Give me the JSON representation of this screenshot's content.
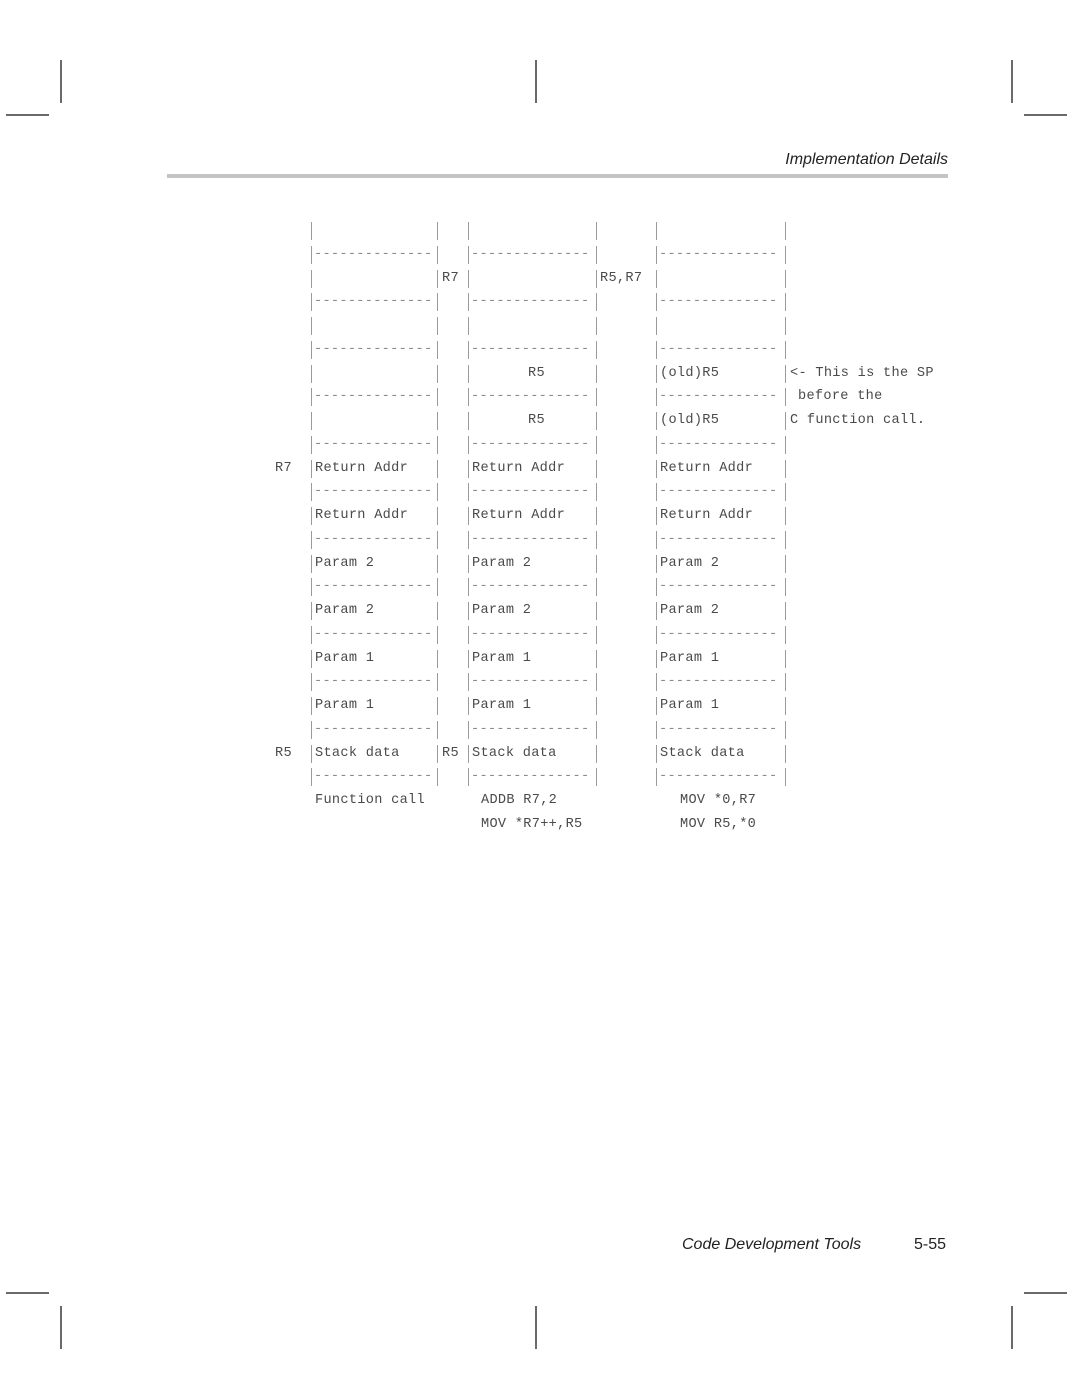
{
  "header": {
    "section_title": "Implementation Details"
  },
  "footer": {
    "chapter_title": "Code Development Tools",
    "page_number": "5-55"
  },
  "stack_diagram": {
    "columns": [
      {
        "name": "function-call",
        "pointer_label_right": "R7",
        "cells": [
          "",
          "",
          "",
          "",
          "Return Addr",
          "Return Addr",
          "Param 2",
          "Param 2",
          "Param 1",
          "Param 1",
          "Stack data"
        ],
        "left_labels": {
          "4": "R7",
          "10": "R5"
        },
        "right_labels": {
          "0": "R7",
          "10": "R5"
        },
        "caption": [
          "Function call"
        ]
      },
      {
        "name": "addb-mov",
        "cells": [
          "",
          "",
          "",
          "R5",
          "R5",
          "Return Addr",
          "Return Addr",
          "Param 2",
          "Param 2",
          "Param 1",
          "Param 1",
          "Stack data"
        ],
        "right_labels": {
          "0": "R5,R7"
        },
        "caption": [
          "ADDB R7,2",
          "MOV *R7++,R5"
        ]
      },
      {
        "name": "mov-sp",
        "cells": [
          "",
          "",
          "",
          "(old)R5",
          "(old)R5",
          "Return Addr",
          "Return Addr",
          "Param 2",
          "Param 2",
          "Param 1",
          "Param 1",
          "Stack data"
        ],
        "caption": [
          "MOV *0,R7",
          "MOV R5,*0"
        ]
      }
    ],
    "annotation": [
      "<- This is the SP",
      "before the",
      "C function call."
    ]
  },
  "rows": {
    "r0": {
      "c1": "",
      "c2": "",
      "c3": ""
    },
    "r2": {
      "c1": "",
      "c1_right": "R7",
      "c2": "",
      "c2_right": "R5,R7",
      "c3": ""
    },
    "r4": {
      "c1": "",
      "c2": "",
      "c3": ""
    },
    "r6": {
      "c1": "",
      "c2": "R5",
      "c3": "(old)R5",
      "note": "<- This is the SP"
    },
    "r7": {
      "note": "before the"
    },
    "r8": {
      "c1": "",
      "c2": "R5",
      "c3": "(old)R5",
      "note": "C function call."
    },
    "r10": {
      "left": "R7",
      "c1": "Return Addr",
      "c2": "Return Addr",
      "c3": "Return Addr"
    },
    "r12": {
      "c1": "Return Addr",
      "c2": "Return Addr",
      "c3": "Return Addr"
    },
    "r14": {
      "c1": "Param 2",
      "c2": "Param 2",
      "c3": "Param 2"
    },
    "r16": {
      "c1": "Param 2",
      "c2": "Param 2",
      "c3": "Param 2"
    },
    "r18": {
      "c1": "Param 1",
      "c2": "Param 1",
      "c3": "Param 1"
    },
    "r20": {
      "c1": "Param 1",
      "c2": "Param 1",
      "c3": "Param 1"
    },
    "r22": {
      "left": "R5",
      "c1": "Stack data",
      "c1_right": "R5",
      "c2": "Stack data",
      "c3": "Stack data"
    },
    "r24": {
      "c1": "Function call",
      "c2": "ADDB R7,2",
      "c3": "MOV *0,R7"
    },
    "r25": {
      "c2": "MOV *R7++,R5",
      "c3": "MOV R5,*0"
    }
  },
  "dash_line": "--------------"
}
